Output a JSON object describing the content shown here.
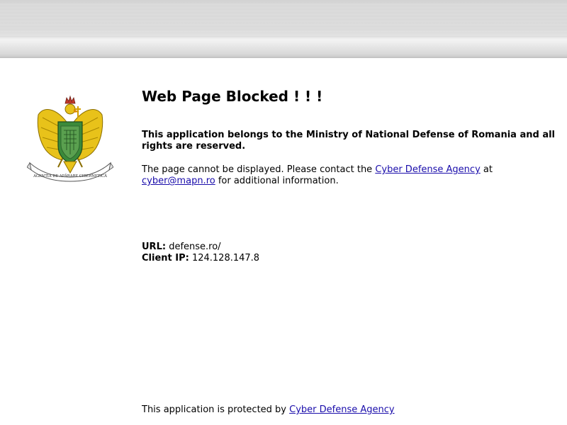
{
  "header": {
    "title": "Web Page Blocked ! ! !"
  },
  "notice": {
    "lead": "This application belongs to the Ministry of National Defense of Romania and all rights are reserved.",
    "message_prefix": "The page cannot be displayed. Please contact the ",
    "agency_link": "Cyber Defense Agency",
    "message_mid": " at",
    "email_link": "cyber@mapn.ro",
    "message_suffix": " for additional information."
  },
  "details": {
    "url_label": "URL:",
    "url_value": " defense.ro/",
    "ip_label": "Client IP:",
    "ip_value": " 124.128.147.8"
  },
  "emblem": {
    "banner_text": "AGENȚIA DE APĂRARE CIBERNETICĂ",
    "icon": "eagle-coat-of-arms-icon"
  },
  "footer": {
    "prefix": "This application is protected by ",
    "link": "Cyber Defense Agency"
  },
  "colors": {
    "link": "#1a0dab",
    "eagle_gold": "#e8c21a",
    "shield_green": "#3b8a3a"
  }
}
